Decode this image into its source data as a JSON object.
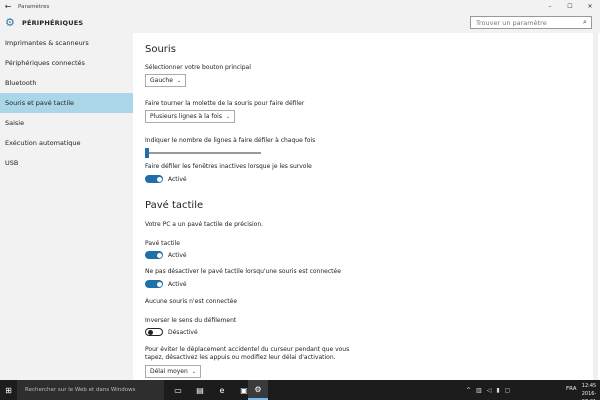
{
  "window": {
    "title": "Paramètres",
    "back_icon": "back-arrow-icon",
    "minimize": "–",
    "maximize": "☐",
    "close": "✕"
  },
  "header": {
    "icon": "gear-icon",
    "title": "PÉRIPHÉRIQUES",
    "search_placeholder": "Trouver un paramètre",
    "search_icon": "search-icon"
  },
  "sidebar": {
    "items": [
      {
        "label": "Imprimantes & scanneurs",
        "active": false
      },
      {
        "label": "Périphériques connectés",
        "active": false
      },
      {
        "label": "Bluetooth",
        "active": false
      },
      {
        "label": "Souris et pavé tactile",
        "active": true
      },
      {
        "label": "Saisie",
        "active": false
      },
      {
        "label": "Exécution automatique",
        "active": false
      },
      {
        "label": "USB",
        "active": false
      }
    ]
  },
  "mouse": {
    "heading": "Souris",
    "primary_button_label": "Sélectionner votre bouton principal",
    "primary_button_value": "Gauche",
    "scroll_label": "Faire tourner la molette de la souris pour faire défiler",
    "scroll_value": "Plusieurs lignes à la fois",
    "lines_label": "Indiquer le nombre de lignes à faire défiler à chaque fois",
    "lines_slider_fraction": 0.0,
    "inactive_label": "Faire défiler les fenêtres inactives lorsque je les survole",
    "inactive_state": "Activé"
  },
  "touchpad": {
    "heading": "Pavé tactile",
    "info": "Votre PC a un pavé tactile de précision.",
    "touchpad_label": "Pavé tactile",
    "touchpad_state": "Activé",
    "keep_on_label": "Ne pas désactiver le pavé tactile lorsqu'une souris est connectée",
    "keep_on_state": "Activé",
    "no_mouse": "Aucune souris n'est connectée",
    "reverse_label": "Inverser le sens du défilement",
    "reverse_state": "Désactivé",
    "delay_text_1": "Pour éviter le déplacement accidentel du curseur pendant que vous",
    "delay_text_2": "tapez, désactivez les appuis ou modifiez leur délai d'activation.",
    "delay_value": "Délai moyen"
  },
  "taskbar": {
    "start_icon": "windows-logo-icon",
    "search_placeholder": "Rechercher sur le Web et dans Windows",
    "apps": [
      "task-view-icon",
      "file-explorer-icon",
      "edge-icon",
      "store-icon",
      "settings-icon"
    ],
    "language": "FRA",
    "time": "12:45",
    "date": "2016-07-01"
  }
}
